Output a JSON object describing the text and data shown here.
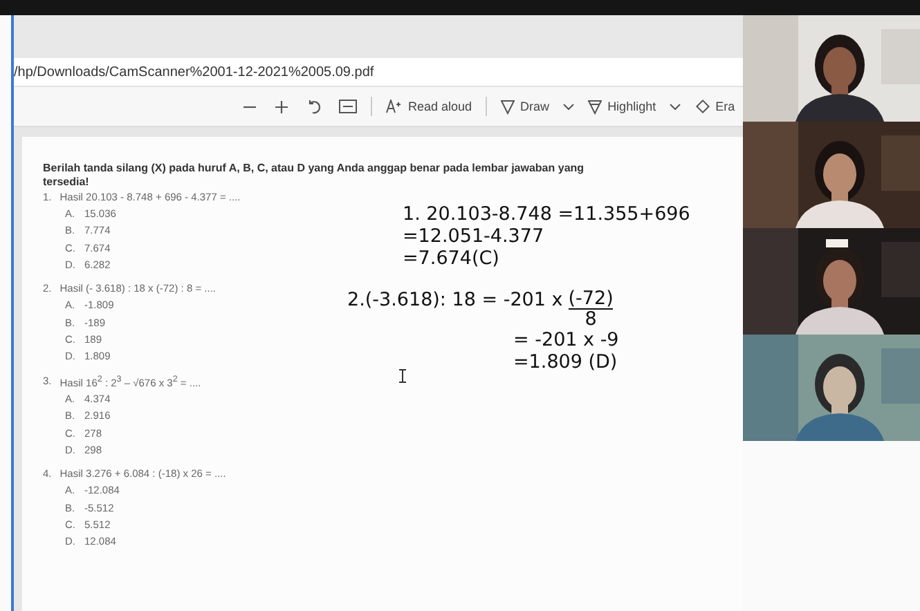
{
  "address_bar": {
    "path": "/hp/Downloads/CamScanner%2001-12-2021%2005.09.pdf"
  },
  "toolbar": [
    {
      "kind": "zoom-out"
    },
    {
      "kind": "zoom-in"
    },
    {
      "kind": "rotate"
    },
    {
      "kind": "fit"
    },
    {
      "kind": "read",
      "label": "Read aloud"
    },
    {
      "kind": "draw",
      "label": "Draw"
    },
    {
      "kind": "highlight",
      "label": "Highlight"
    },
    {
      "kind": "erase",
      "label": "Era"
    }
  ],
  "document": {
    "instruction": "Berilah tanda silang (X) pada huruf A, B, C, atau D yang Anda anggap benar pada lembar jawaban yang tersedia!",
    "questions": [
      {
        "number": "1.",
        "text": "Hasil 20.103 - 8.748 + 696 - 4.377 = ....",
        "options": [
          {
            "letter": "A.",
            "text": "15.036"
          },
          {
            "letter": "B.",
            "text": "7.774"
          },
          {
            "letter": "C.",
            "text": "7.674"
          },
          {
            "letter": "D.",
            "text": "6.282"
          }
        ]
      },
      {
        "number": "2.",
        "text": "Hasil (- 3.618) : 18 x (-72) : 8 = ....",
        "options": [
          {
            "letter": "A.",
            "text": "-1.809"
          },
          {
            "letter": "B.",
            "text": "-189"
          },
          {
            "letter": "C.",
            "text": "189"
          },
          {
            "letter": "D.",
            "text": "1.809"
          }
        ]
      },
      {
        "number": "3.",
        "text": "Hasil 16$^{2}$ : 2$^{3}$ – √676 x 3$^{2}$ = ....",
        "options": [
          {
            "letter": "A.",
            "text": "4.374"
          },
          {
            "letter": "B.",
            "text": "2.916"
          },
          {
            "letter": "C.",
            "text": "278"
          },
          {
            "letter": "D.",
            "text": "298"
          }
        ]
      },
      {
        "number": "4.",
        "text": "Hasil 3.276 + 6.084 : (-18) x 26 = ....",
        "options": [
          {
            "letter": "A.",
            "text": "-12.084"
          },
          {
            "letter": "B.",
            "text": "-5.512"
          },
          {
            "letter": "C.",
            "text": "5.512"
          },
          {
            "letter": "D.",
            "text": "12.084"
          }
        ]
      }
    ]
  },
  "worked_answers": [
    {
      "lines": [
        {
          "text": "1. 20.103-8.748 =11.355+696"
        },
        {
          "text": "=12.051-4.377"
        },
        {
          "text": "=7.674(C)"
        }
      ]
    },
    {
      "lines": [
        {
          "text": "2.(-3.618): 18 = -201 x",
          "numerator": "(-72)",
          "denominator": "8"
        },
        {
          "text": "= -201 x -9"
        },
        {
          "text": "=1.809 (D)"
        }
      ]
    }
  ]
}
